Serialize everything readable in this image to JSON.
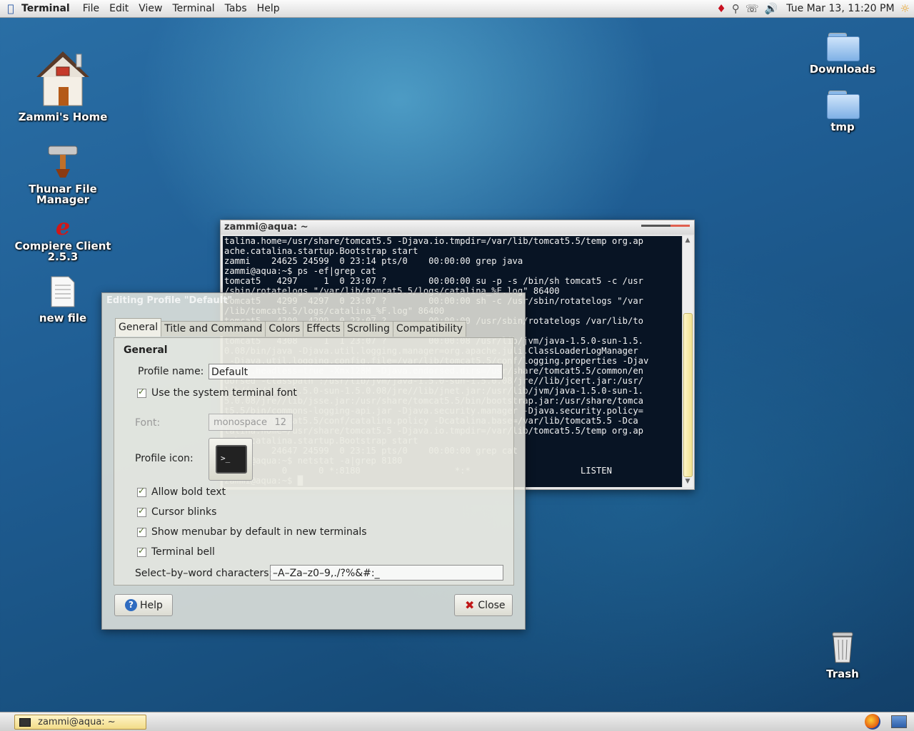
{
  "top_panel": {
    "app_name": "Terminal",
    "menus": [
      "File",
      "Edit",
      "View",
      "Terminal",
      "Tabs",
      "Help"
    ],
    "clock": "Tue Mar 13, 11:20 PM",
    "tray_icons": [
      "ruby-icon",
      "search-icon",
      "phone-icon",
      "volume-icon",
      "weather-icon"
    ]
  },
  "desktop": {
    "icons": [
      {
        "label": "Zammi's Home",
        "icon": "home-icon"
      },
      {
        "label": "Thunar File Manager",
        "icon": "file-manager-icon"
      },
      {
        "label": "Compiere Client 2.5.3",
        "icon": "compiere-icon"
      },
      {
        "label": "new file",
        "icon": "text-file-icon"
      },
      {
        "label": "Downloads",
        "icon": "folder-icon"
      },
      {
        "label": "tmp",
        "icon": "folder-icon"
      },
      {
        "label": "Trash",
        "icon": "trash-icon"
      }
    ]
  },
  "terminal": {
    "title": "zammi@aqua: ~",
    "lines": [
      "talina.home=/usr/share/tomcat5.5 -Djava.io.tmpdir=/var/lib/tomcat5.5/temp org.ap",
      "ache.catalina.startup.Bootstrap start",
      "zammi    24625 24599  0 23:14 pts/0    00:00:00 grep java",
      "zammi@aqua:~$ ps -ef|grep cat",
      "tomcat5   4297     1  0 23:07 ?        00:00:00 su -p -s /bin/sh tomcat5 -c /usr",
      "/sbin/rotatelogs \"/var/lib/tomcat5.5/logs/catalina_%F.log\" 86400",
      "tomcat5   4299  4297  0 23:07 ?        00:00:00 sh -c /usr/sbin/rotatelogs \"/var",
      "/lib/tomcat5.5/logs/catalina_%F.log\" 86400",
      "tomcat5   4300  4299  0 23:07 ?        00:00:00 /usr/sbin/rotatelogs /var/lib/to",
      "mcat5.5/logs/catalina_%F.log 86400",
      "tomcat5   4308     1  1 23:07 ?        00:00:08 /usr/lib/jvm/java-1.5.0-sun-1.5.",
      "0.08/bin/java -Djava.util.logging.manager=org.apache.juli.ClassLoaderLogManager",
      " -Djava.util.logging.config.file=/var/lib/tomcat5.5/conf/logging.properties -Djav",
      "a.awt.headless=true -Xmx128M -Djava.endorsed.dirs=/usr/share/tomcat5.5/common/en",
      "dorsed -classpath :/usr/lib/jvm/java-1.5.0-sun-1.5.0.08/jre//lib/jcert.jar:/usr/",
      "lib/jvm/java-1.5.0-sun-1.5.0.08/jre//lib/jnet.jar:/usr/lib/jvm/java-1.5.0-sun-1.",
      "5.0.08/jre//lib/jsse.jar:/usr/share/tomcat5.5/bin/bootstrap.jar:/usr/share/tomca",
      "t5.5/bin/commons-logging-api.jar -Djava.security.manager -Djava.security.policy=",
      "/var/lib/tomcat5.5/conf/catalina.policy -Dcatalina.base=/var/lib/tomcat5.5 -Dca",
      "talina.home=/usr/share/tomcat5.5 -Djava.io.tmpdir=/var/lib/tomcat5.5/temp org.ap",
      "ache.catalina.startup.Bootstrap start",
      "zammi    24647 24599  0 23:15 pts/0    00:00:00 grep cat",
      "zammi@aqua:~$ netstat -a|grep 8180",
      "tcp        0      0 *:8180                  *:*                     LISTEN",
      "zammi@aqua:~$ █"
    ]
  },
  "dialog": {
    "title": "Editing Profile \"Default\"",
    "tabs": [
      "General",
      "Title and Command",
      "Colors",
      "Effects",
      "Scrolling",
      "Compatibility"
    ],
    "section": "General",
    "profile_name_label": "Profile name:",
    "profile_name_value": "Default",
    "use_system_font": "Use the system terminal font",
    "font_label": "Font:",
    "font_value": "monospace",
    "font_size": "12",
    "profile_icon_label": "Profile icon:",
    "allow_bold": "Allow bold text",
    "cursor_blinks": "Cursor blinks",
    "show_menubar": "Show menubar by default in new terminals",
    "terminal_bell": "Terminal bell",
    "select_word_label": "Select–by–word characters:",
    "select_word_value": "–A–Za–z0–9,./?%&#:_",
    "help_button": "Help",
    "close_button": "Close"
  },
  "bottom_panel": {
    "taskbar_entry": "zammi@aqua: ~"
  }
}
